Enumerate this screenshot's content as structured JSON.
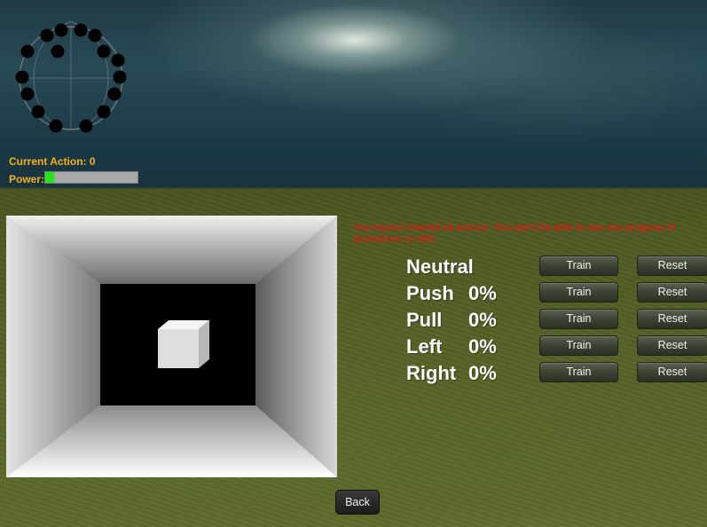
{
  "hud": {
    "current_action": "Current Action: 0",
    "power_label": "Power:",
    "power_level": 0.1
  },
  "headset": {
    "sensor_count": 14,
    "colors": {
      "sensor": "#000000",
      "outline": "#888888"
    }
  },
  "warning": "You haven't trained all actions. You won't be able to see any progress in animations or skill.",
  "actions": [
    {
      "name": "Neutral",
      "percent": "",
      "train_label": "Train",
      "reset_label": "Reset"
    },
    {
      "name": "Push",
      "percent": "0%",
      "train_label": "Train",
      "reset_label": "Reset"
    },
    {
      "name": "Pull",
      "percent": "0%",
      "train_label": "Train",
      "reset_label": "Reset"
    },
    {
      "name": "Left",
      "percent": "0%",
      "train_label": "Train",
      "reset_label": "Reset"
    },
    {
      "name": "Right",
      "percent": "0%",
      "train_label": "Train",
      "reset_label": "Reset"
    }
  ],
  "back_label": "Back",
  "colors": {
    "hud_text": "#f4b21b",
    "power_fill": "#22e61a",
    "warning_text": "#ee1414",
    "button_bg": "#3e4436"
  }
}
